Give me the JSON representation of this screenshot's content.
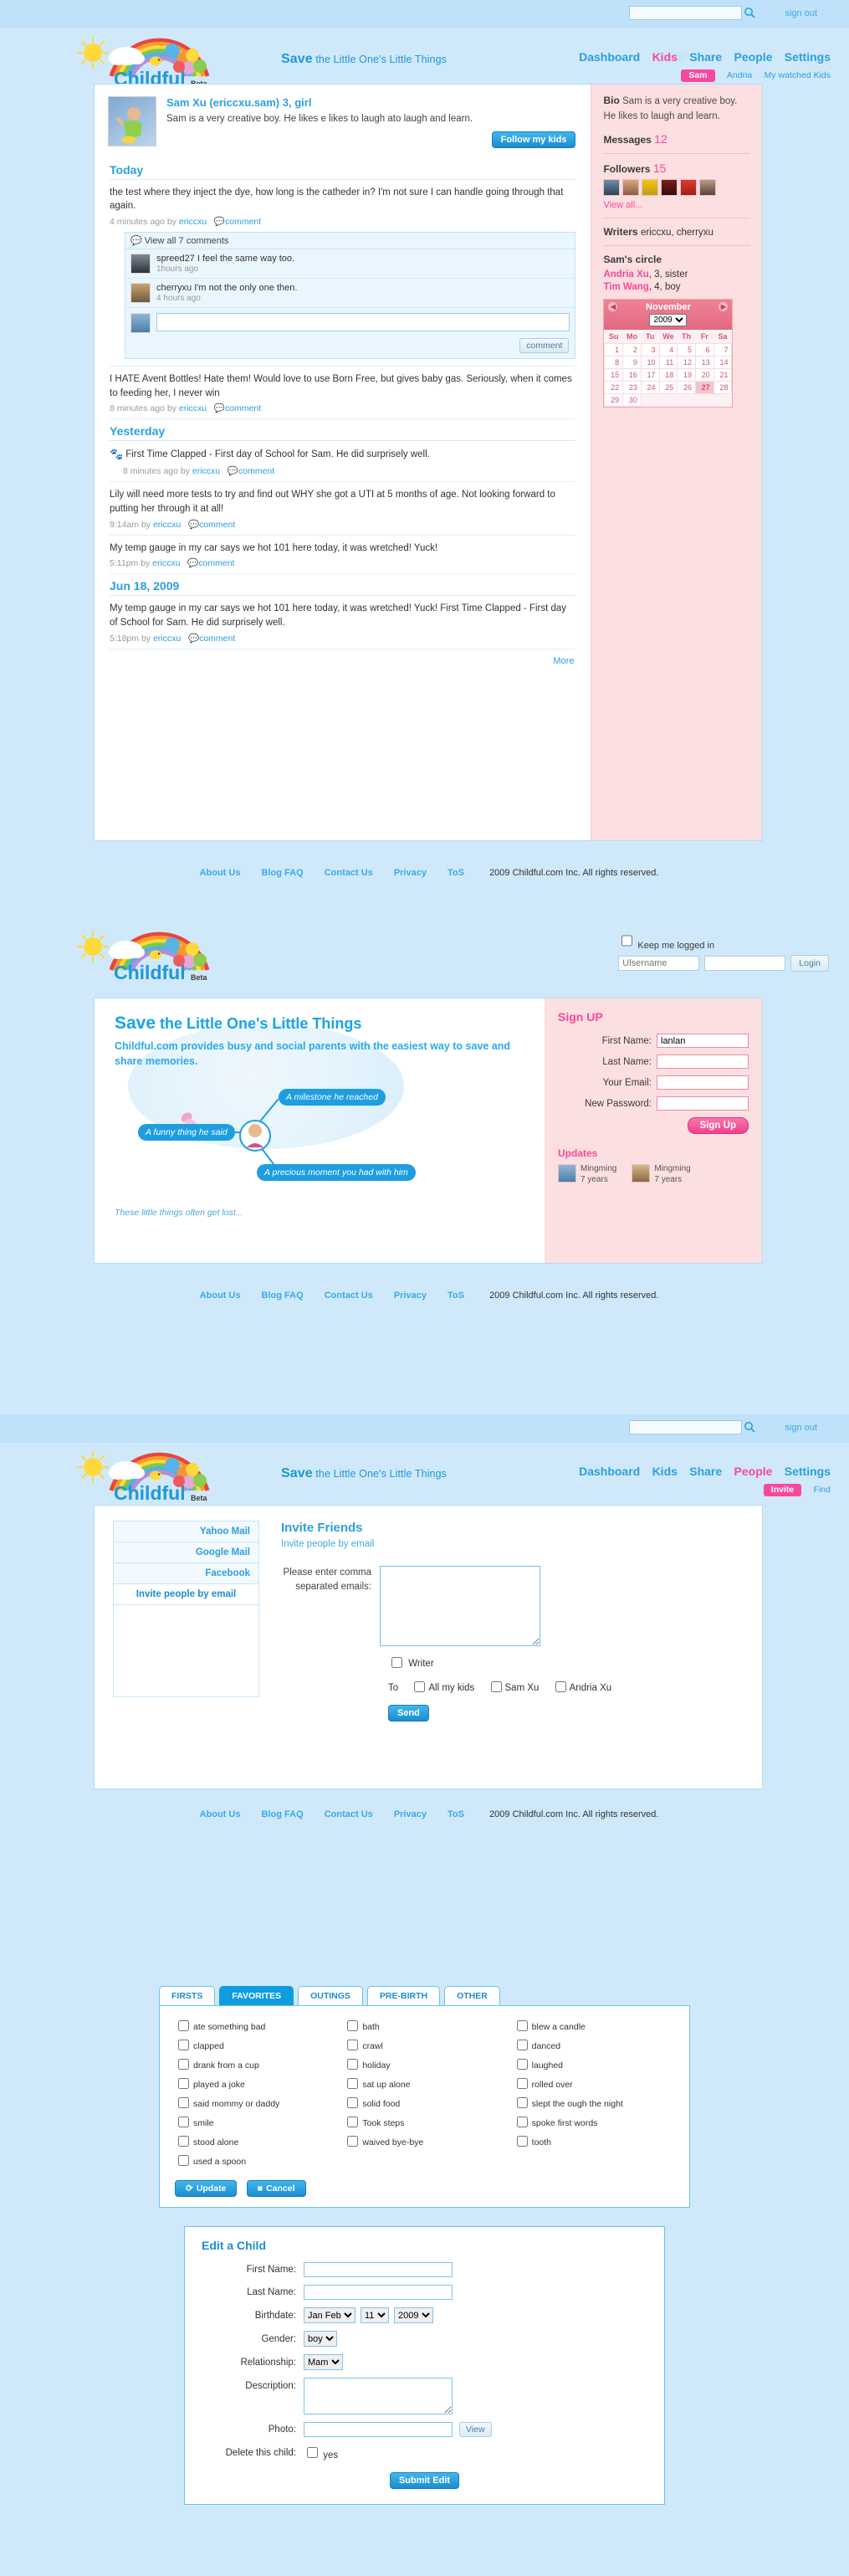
{
  "brand": {
    "name": "Childful",
    "beta": "Beta"
  },
  "tagline": {
    "save": "Save",
    "rest": " the Little One's Little Things"
  },
  "topbar": {
    "search_placeholder": "",
    "search_value": "",
    "signout": "sign out",
    "search_icon": "search-icon"
  },
  "nav": {
    "items": [
      {
        "label": "Dashboard",
        "active": false
      },
      {
        "label": "Kids",
        "active": true
      },
      {
        "label": "Share",
        "active": false
      },
      {
        "label": "People",
        "active": false
      },
      {
        "label": "Settings",
        "active": false
      }
    ],
    "sub": [
      {
        "label": "Sam",
        "pill": true
      },
      {
        "label": "Andria",
        "pill": false
      },
      {
        "label": "My watched Kids",
        "pill": false
      }
    ]
  },
  "nav_people": {
    "items": [
      {
        "label": "Dashboard",
        "active": false
      },
      {
        "label": "Kids",
        "active": false
      },
      {
        "label": "Share",
        "active": false
      },
      {
        "label": "People",
        "active": true
      },
      {
        "label": "Settings",
        "active": false
      }
    ],
    "sub": [
      {
        "label": "Invite",
        "pill": true
      },
      {
        "label": "Find",
        "pill": false
      }
    ]
  },
  "profile": {
    "name": "Sam Xu",
    "handle": "(ericcxu.sam)",
    "age_gender": "3, girl",
    "bio": "Sam is a very creative boy. He likes e likes to laugh ato laugh and learn.",
    "follow_button": "Follow my kids"
  },
  "feed": {
    "sections": [
      {
        "title": "Today",
        "posts": [
          {
            "text": "the test where they inject the dye, how long is the catheder in? I'm not sure I can handle going through that again.",
            "time": "4 minutes ago by",
            "author": "ericcxu",
            "comment_label": "comment",
            "has_comments": true
          },
          {
            "text": "I HATE Avent Bottles! Hate them! Would love to use Born Free, but gives baby gas. Seriously, when it comes to feeding her, I never win",
            "time": "8 minutes ago by",
            "author": "ericcxu",
            "comment_label": "comment",
            "has_comments": false
          }
        ]
      },
      {
        "title": "Yesterday",
        "posts": [
          {
            "text": "First Time Clapped - First day of School for Sam. He did surprisely well.",
            "time": "8 minutes ago by",
            "author": "ericcxu",
            "comment_label": "comment",
            "icon": "footprint-icon",
            "has_comments": false
          },
          {
            "text": "Lily will need more tests to try and find out WHY she got a UTI at 5 months of age. Not looking forward to putting her through it at all!",
            "time": "9:14am by",
            "author": "ericcxu",
            "comment_label": "comment",
            "has_comments": false
          },
          {
            "text": "My temp gauge in my car says we hot 101 here today, it was wretched! Yuck!",
            "time": "5:11pm by",
            "author": "ericcxu",
            "comment_label": "comment",
            "has_comments": false
          }
        ]
      },
      {
        "title": "Jun 18, 2009",
        "posts": [
          {
            "text": "My temp gauge in my car says we hot 101 here today, it was wretched! Yuck! First Time Clapped - First day of School for Sam. He did surprisely well.",
            "time": "5:18pm  by",
            "author": "ericcxu",
            "comment_label": "comment",
            "has_comments": false
          }
        ]
      }
    ],
    "more": "More"
  },
  "comments": {
    "view_all": "View all 7 comments",
    "list": [
      {
        "text": "spreed27 I feel the same way too.",
        "time": "1hours ago"
      },
      {
        "text": "cherryxu I'm not the only one then.",
        "time": "4 hours ago"
      }
    ],
    "input_value": "",
    "submit": "comment"
  },
  "rail": {
    "bio_label": "Bio",
    "bio_text": "Sam is a very creative boy. He likes to laugh and learn.",
    "messages_label": "Messages",
    "messages_count": "12",
    "followers_label": "Followers",
    "followers_count": "15",
    "view_all": "View all...",
    "writers_label": "Writers",
    "writers_value": "ericcxu, cherryxu",
    "circle_title": "Sam's circle",
    "circle": [
      {
        "name": "Andria Xu",
        "rest": ", 3, sister"
      },
      {
        "name": "Tim Wang",
        "rest": ", 4, boy"
      }
    ]
  },
  "calendar": {
    "month": "November",
    "year": "2009",
    "prev_icon": "chevron-left-icon",
    "next_icon": "chevron-right-icon",
    "weekdays": [
      "Su",
      "Mo",
      "Tu",
      "We",
      "Th",
      "Fr",
      "Sa"
    ],
    "weeks": [
      [
        "",
        "",
        "",
        "",
        "",
        "",
        ""
      ],
      [
        "1",
        "2",
        "3",
        "4",
        "5",
        "6",
        "7"
      ],
      [
        "8",
        "9",
        "10",
        "11",
        "12",
        "13",
        "14"
      ],
      [
        "15",
        "16",
        "17",
        "18",
        "19",
        "20",
        "21"
      ],
      [
        "22",
        "23",
        "24",
        "25",
        "26",
        "27",
        "28"
      ],
      [
        "29",
        "30",
        "",
        "",
        "",
        "",
        ""
      ]
    ],
    "today": "27"
  },
  "footer": {
    "links": [
      "About Us",
      "Blog FAQ",
      "Contact Us",
      "Privacy",
      "ToS"
    ],
    "copyright": "2009 Childful.com Inc. All rights reserved."
  },
  "login": {
    "keep_label": "Keep me logged in",
    "username_placeholder": "Ulsername",
    "username_value": "",
    "password_value": "",
    "button": "Login"
  },
  "hero": {
    "h1_save": "Save",
    "h1_rest": " the Little One's Little Things",
    "sub": "Childful.com provides busy and social parents with the easiest way to save and share memories.",
    "bubbles": [
      {
        "text": "A milestone he reached"
      },
      {
        "text": "A funny thing he said"
      },
      {
        "text": "A precious moment you had with him"
      }
    ],
    "note": "These little things often get lost..."
  },
  "signup": {
    "title": "Sign UP",
    "fields": [
      {
        "label": "First Name:",
        "value": "lanlan"
      },
      {
        "label": "Last Name:",
        "value": ""
      },
      {
        "label": "Your Email:",
        "value": ""
      },
      {
        "label": "New Password:",
        "value": ""
      }
    ],
    "button": "Sign Up",
    "updates_title": "Updates",
    "updates": [
      {
        "name": "Mingming",
        "age": "7 years"
      },
      {
        "name": "Mingming",
        "age": "7 years"
      }
    ]
  },
  "invite": {
    "left_items": [
      {
        "label": "Yahoo Mail",
        "selected": false
      },
      {
        "label": "Google Mail",
        "selected": false
      },
      {
        "label": "Facebook",
        "selected": false
      },
      {
        "label": "Invite people by email",
        "selected": true
      }
    ],
    "heading": "Invite Friends",
    "subheading": "Invite people by email",
    "email_label": "Please enter comma separated emails:",
    "email_value": "",
    "writer_label": "Writer",
    "to_label": "To",
    "to_options": [
      "All my kids",
      "Sam Xu",
      "Andria Xu"
    ],
    "send_button": "Send"
  },
  "milestones": {
    "tabs": [
      {
        "label": "FIRSTS",
        "active": false
      },
      {
        "label": "FAVORITES",
        "active": true
      },
      {
        "label": "OUTINGS",
        "active": false
      },
      {
        "label": "PRE-BIRTH",
        "active": false
      },
      {
        "label": "OTHER",
        "active": false
      }
    ],
    "column1": [
      "ate something bad",
      "clapped",
      "drank from a cup",
      "played a joke",
      "said mommy or daddy",
      "smile",
      "stood alone",
      "used a spoon"
    ],
    "column2": [
      "bath",
      "crawl",
      "holiday",
      "sat up alone",
      "solid food",
      "Took steps",
      "waived bye-bye"
    ],
    "column3": [
      "blew a candle",
      "danced",
      "laughed",
      "rolled over",
      "slept the ough the night",
      "spoke first words",
      "tooth"
    ],
    "update_button": "Update",
    "cancel_button": "Cancel"
  },
  "edit_child": {
    "title": "Edit a Child",
    "first_name_label": "First Name:",
    "first_name_value": "",
    "last_name_label": "Last Name:",
    "last_name_value": "",
    "birthdate_label": "Birthdate:",
    "birthdate_month": "Jan Feb",
    "birthdate_day": "11",
    "birthdate_year": "2009",
    "gender_label": "Gender:",
    "gender_value": "boy",
    "relationship_label": "Relationship:",
    "relationship_value": "Mam",
    "description_label": "Description:",
    "description_value": "",
    "photo_label": "Photo:",
    "photo_value": "",
    "view_button": "View",
    "delete_label": "Delete this child:",
    "delete_yes": "yes",
    "submit_button": "Submit Edit"
  }
}
